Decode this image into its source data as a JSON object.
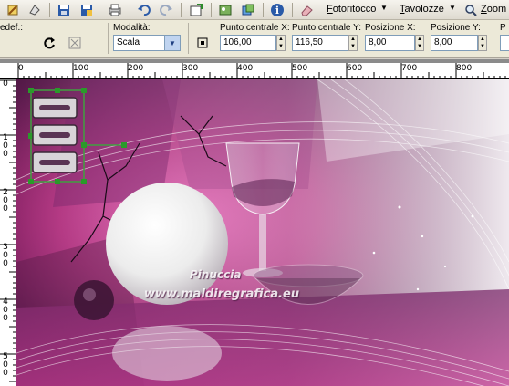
{
  "toolbar": {
    "menus": [
      {
        "label": "Fotoritocco",
        "accesskey": "F"
      },
      {
        "label": "Tavolozze",
        "accesskey": "T"
      },
      {
        "label": "Zoom",
        "accesskey": "Z"
      }
    ],
    "icons": [
      "brush-icon",
      "clone-icon",
      "save-icon",
      "save-as-icon",
      "print-icon",
      "undo-icon",
      "redo-icon",
      "new-window-icon",
      "import-icon",
      "browse-icon",
      "info-icon",
      "eraser-icon",
      "search-icon"
    ]
  },
  "options": {
    "preset_label": "edef.:",
    "mode_label": "Modalità:",
    "mode_value": "Scala",
    "center_x_label": "Punto centrale X:",
    "center_x_value": "106,00",
    "center_y_label": "Punto centrale Y:",
    "center_y_value": "116,50",
    "pos_x_label": "Posizione X:",
    "pos_x_value": "8,00",
    "pos_y_label": "Posizione Y:",
    "pos_y_value": "8,00",
    "extra_label": "P"
  },
  "ruler": {
    "horizontal": [
      "0",
      "100",
      "200",
      "300",
      "400",
      "500",
      "600",
      "700",
      "800"
    ],
    "vertical": [
      "100",
      "200",
      "300",
      "400",
      "500"
    ]
  },
  "canvas": {
    "watermark_line1": "Pinuccia",
    "watermark_line2": "www.maldiregrafica.eu",
    "colors": {
      "magenta": "#c2408f",
      "dark_purple": "#4a1840",
      "light": "#f4f0f4"
    }
  }
}
